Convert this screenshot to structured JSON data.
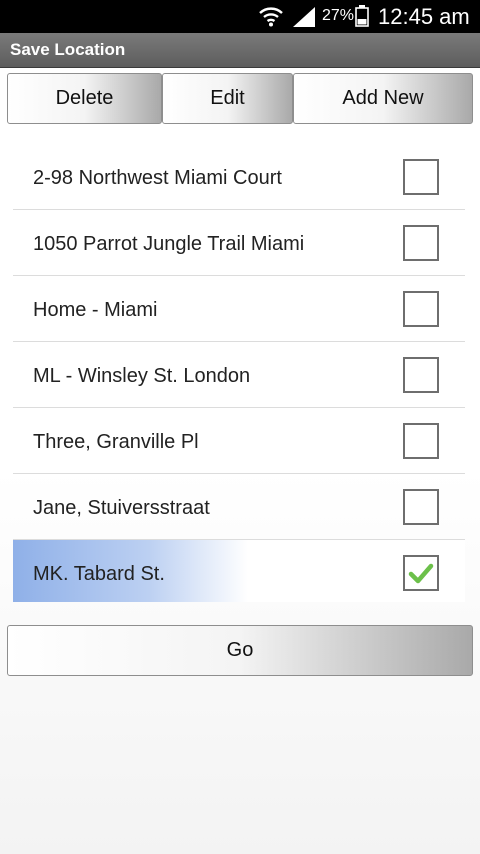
{
  "status_bar": {
    "battery_percent": "27%",
    "time": "12:45 am",
    "icons": [
      "wifi-icon",
      "signal-icon",
      "battery-icon"
    ]
  },
  "title_bar": {
    "title": "Save Location"
  },
  "toolbar": {
    "delete_label": "Delete",
    "edit_label": "Edit",
    "add_new_label": "Add New"
  },
  "locations": [
    {
      "label": "2-98 Northwest Miami Court",
      "checked": false
    },
    {
      "label": "1050 Parrot Jungle Trail Miami",
      "checked": false
    },
    {
      "label": "Home - Miami",
      "checked": false
    },
    {
      "label": "ML - Winsley St. London",
      "checked": false
    },
    {
      "label": "Three, Granville Pl",
      "checked": false
    },
    {
      "label": "Jane, Stuiversstraat",
      "checked": false
    },
    {
      "label": "MK. Tabard St.",
      "checked": true
    }
  ],
  "go_label": "Go",
  "colors": {
    "selected_highlight": "#8fb0e8",
    "check_mark": "#6cc04a",
    "title_bar": "#6a6a6a"
  }
}
